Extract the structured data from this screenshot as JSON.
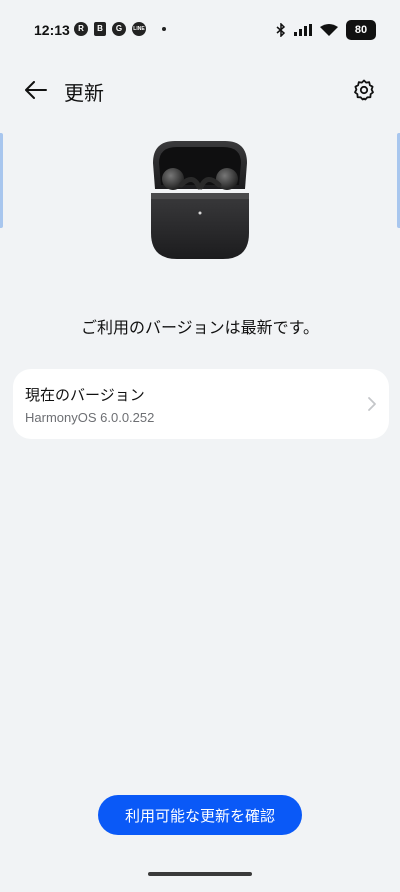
{
  "status_bar": {
    "time": "12:13",
    "battery": "80",
    "left_icons": [
      "R",
      "B",
      "G",
      "LINE"
    ],
    "right_icons": [
      "bluetooth-icon",
      "signal-icon",
      "wifi-icon",
      "battery-icon"
    ]
  },
  "header": {
    "title": "更新",
    "back_icon": "back-arrow-icon",
    "settings_icon": "gear-icon"
  },
  "main": {
    "device_image": "earbuds-in-case",
    "status_message": "ご利用のバージョンは最新です。",
    "version_card": {
      "label": "現在のバージョン",
      "value": "HarmonyOS 6.0.0.252"
    },
    "check_button_label": "利用可能な更新を確認"
  },
  "colors": {
    "background": "#f1f3f5",
    "card": "#ffffff",
    "accent": "#0a59f7",
    "secondary_text": "#6d6f73"
  }
}
